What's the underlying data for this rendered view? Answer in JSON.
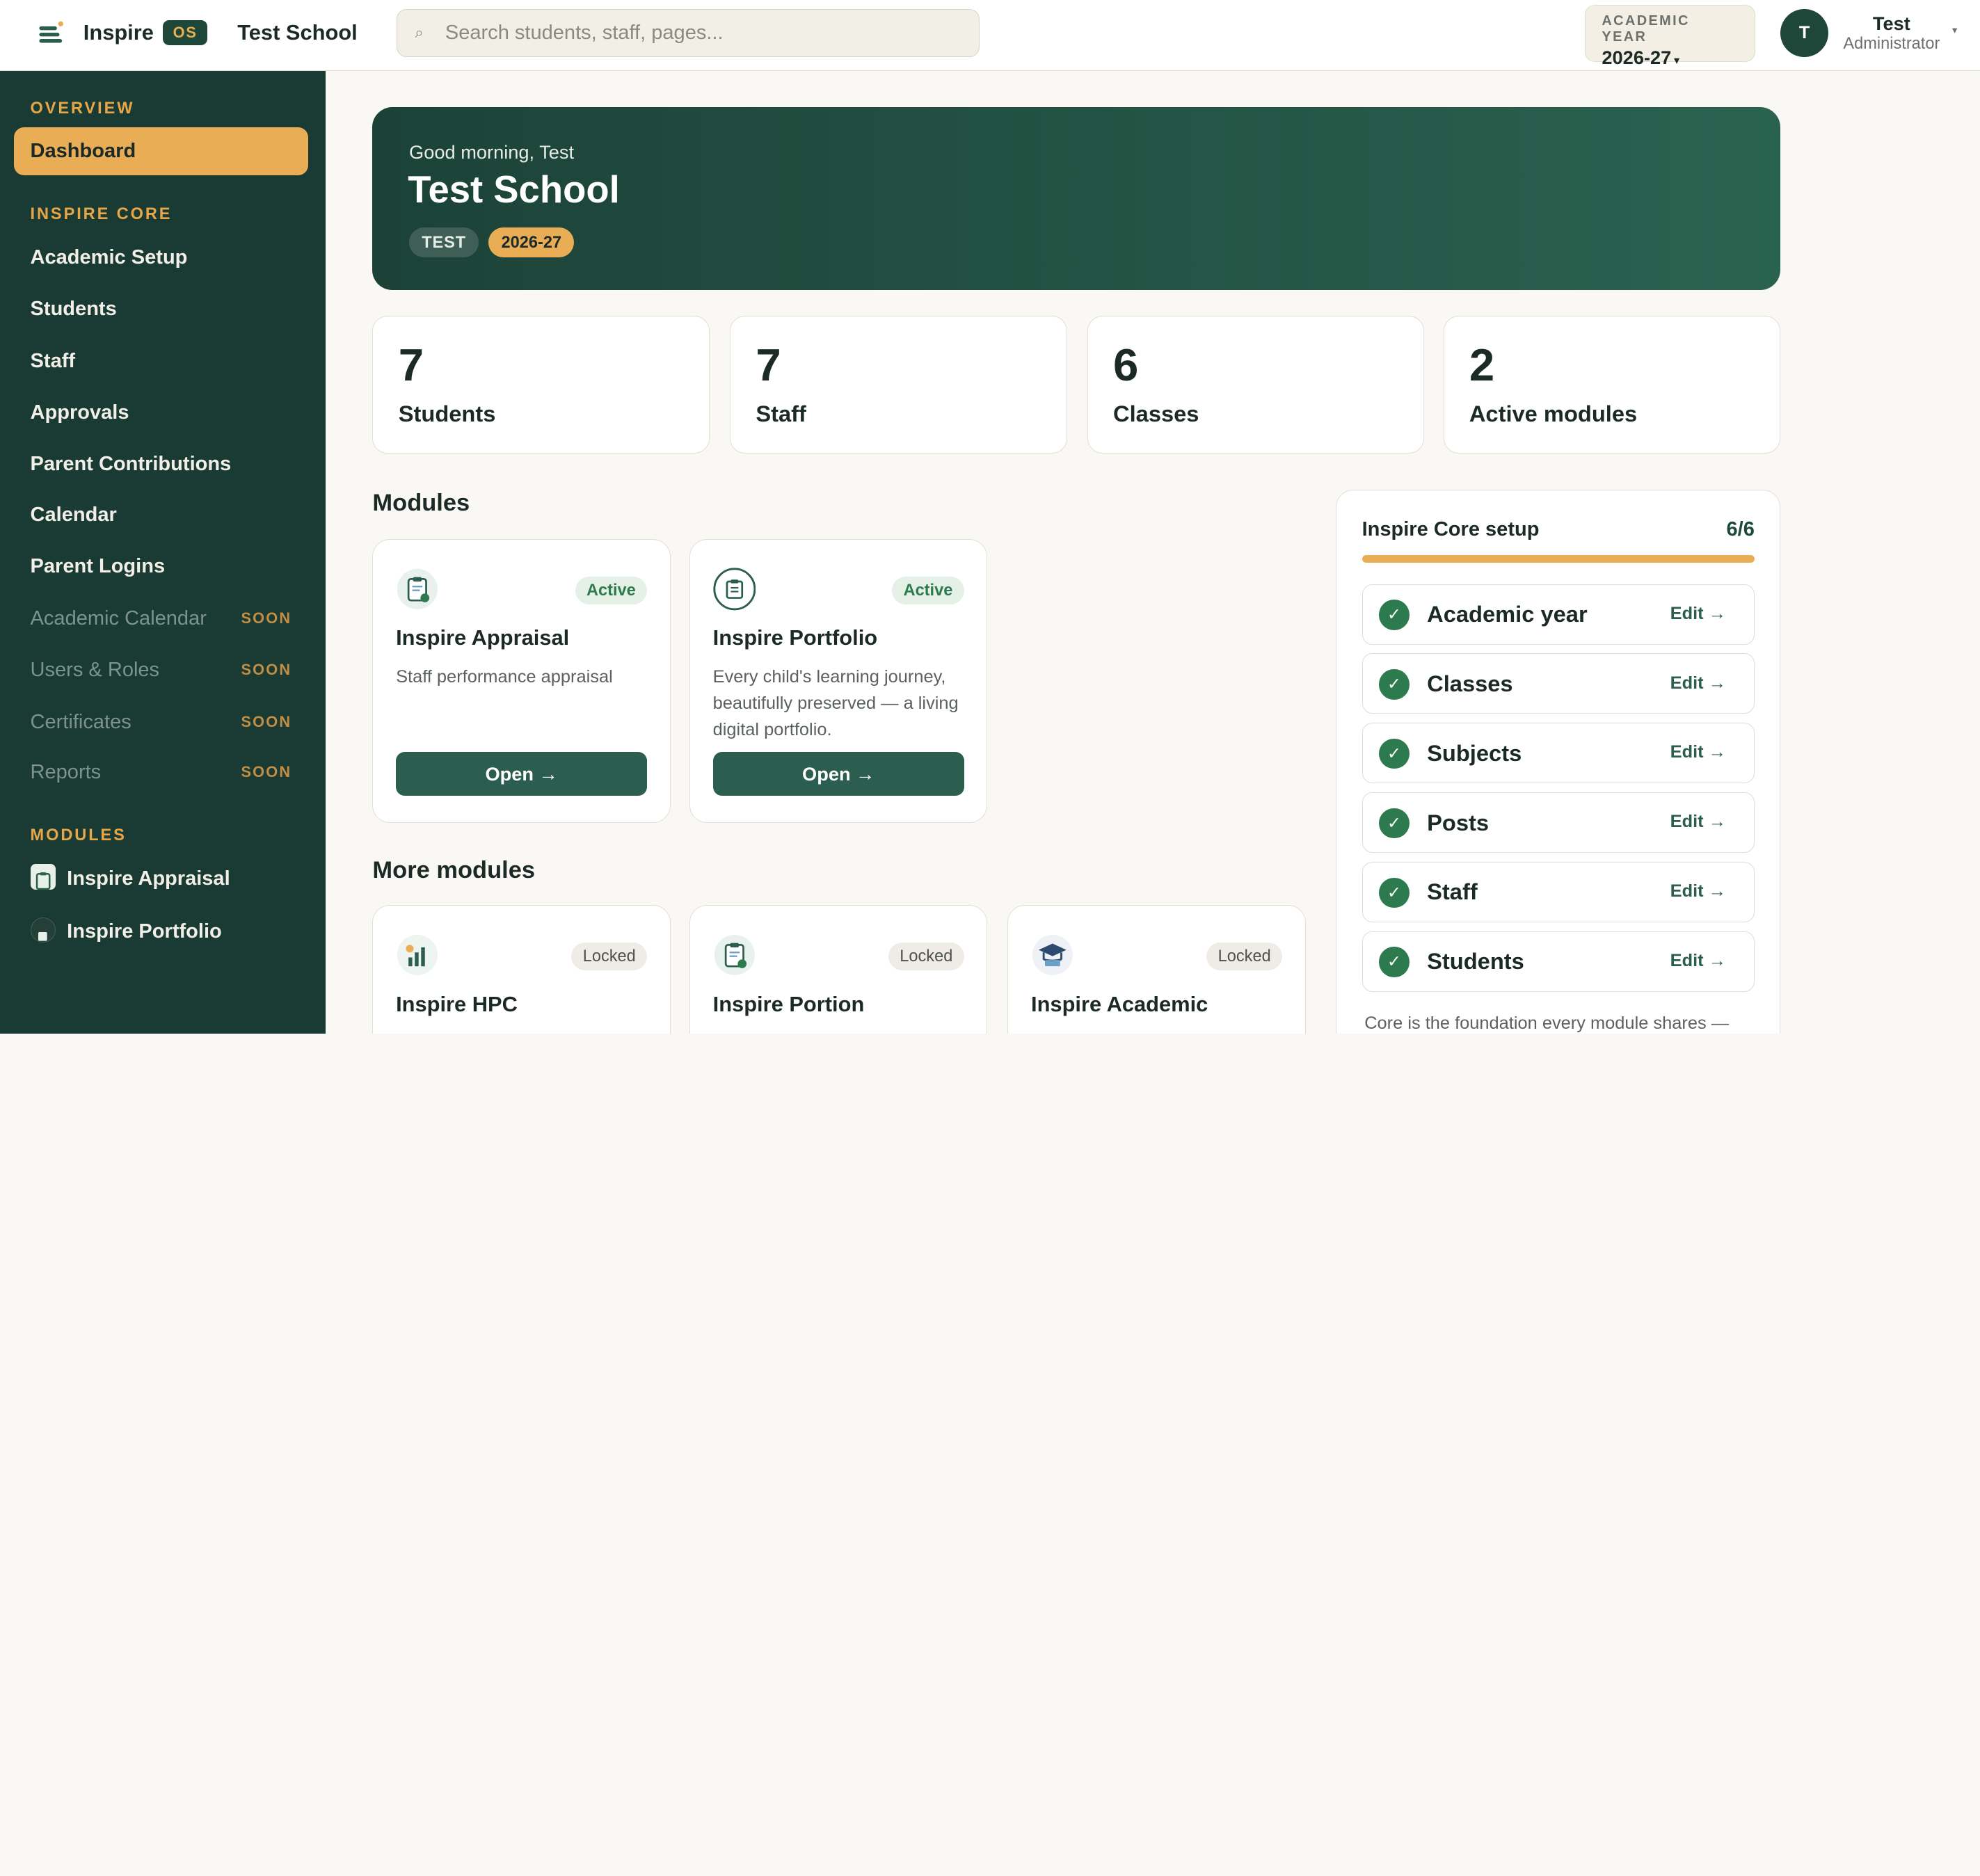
{
  "topbar": {
    "brand": "Inspire",
    "brand_badge": "OS",
    "school_name": "Test School",
    "search_placeholder": "Search students, staff, pages...",
    "search_icon": "search-icon",
    "year_label": "ACADEMIC YEAR",
    "year_value": "2026-27",
    "user_initial": "T",
    "user_name": "Test",
    "user_role": "Administrator"
  },
  "sidebar": {
    "sections": {
      "overview": "OVERVIEW",
      "core": "INSPIRE CORE",
      "modules": "MODULES"
    },
    "overview_items": [
      {
        "label": "Dashboard",
        "active": true
      }
    ],
    "core_items": [
      {
        "label": "Academic Setup"
      },
      {
        "label": "Students"
      },
      {
        "label": "Staff"
      },
      {
        "label": "Approvals"
      },
      {
        "label": "Parent Contributions"
      },
      {
        "label": "Calendar"
      },
      {
        "label": "Parent Logins"
      },
      {
        "label": "Academic Calendar",
        "tag": "SOON"
      },
      {
        "label": "Users & Roles",
        "tag": "SOON"
      },
      {
        "label": "Certificates",
        "tag": "SOON"
      },
      {
        "label": "Reports",
        "tag": "SOON"
      }
    ],
    "module_items": [
      {
        "label": "Inspire Appraisal",
        "icon": "appraisal-icon"
      },
      {
        "label": "Inspire Portfolio",
        "icon": "portfolio-icon"
      }
    ]
  },
  "hero": {
    "greeting": "Good morning, Test",
    "title": "Test School",
    "code_chip": "TEST",
    "year_chip": "2026-27"
  },
  "stats": [
    {
      "value": "7",
      "label": "Students"
    },
    {
      "value": "7",
      "label": "Staff"
    },
    {
      "value": "6",
      "label": "Classes"
    },
    {
      "value": "2",
      "label": "Active modules"
    }
  ],
  "modules": {
    "title": "Modules",
    "items": [
      {
        "name": "Inspire Appraisal",
        "status": "Active",
        "description": "Staff performance appraisal",
        "button": "Open →",
        "icon": "clipboard-check-icon"
      },
      {
        "name": "Inspire Portfolio",
        "status": "Active",
        "description": "Every child's learning journey, beautifully preserved — a living digital portfolio.",
        "button": "Open →",
        "icon": "portfolio-folder-icon"
      }
    ]
  },
  "more_modules": {
    "title": "More modules",
    "items": [
      {
        "name": "Inspire HPC",
        "status": "Locked",
        "icon": "growth-chart-icon"
      },
      {
        "name": "Inspire Portion",
        "status": "Locked",
        "icon": "clipboard-check-icon"
      },
      {
        "name": "Inspire Academic",
        "status": "Locked",
        "icon": "graduation-cap-icon"
      }
    ]
  },
  "core_setup": {
    "title": "Inspire Core setup",
    "count": "6/6",
    "progress": 1.0,
    "items": [
      {
        "label": "Academic year",
        "action": "Edit →"
      },
      {
        "label": "Classes",
        "action": "Edit →"
      },
      {
        "label": "Subjects",
        "action": "Edit →"
      },
      {
        "label": "Posts",
        "action": "Edit →"
      },
      {
        "label": "Staff",
        "action": "Edit →"
      },
      {
        "label": "Students",
        "action": "Edit →"
      }
    ],
    "footer": "Core is the foundation every module shares —"
  },
  "colors": {
    "sidebar_bg": "#193b33",
    "accent": "#e9ad55",
    "primary": "#2c5e50",
    "success": "#2e7a4f"
  }
}
